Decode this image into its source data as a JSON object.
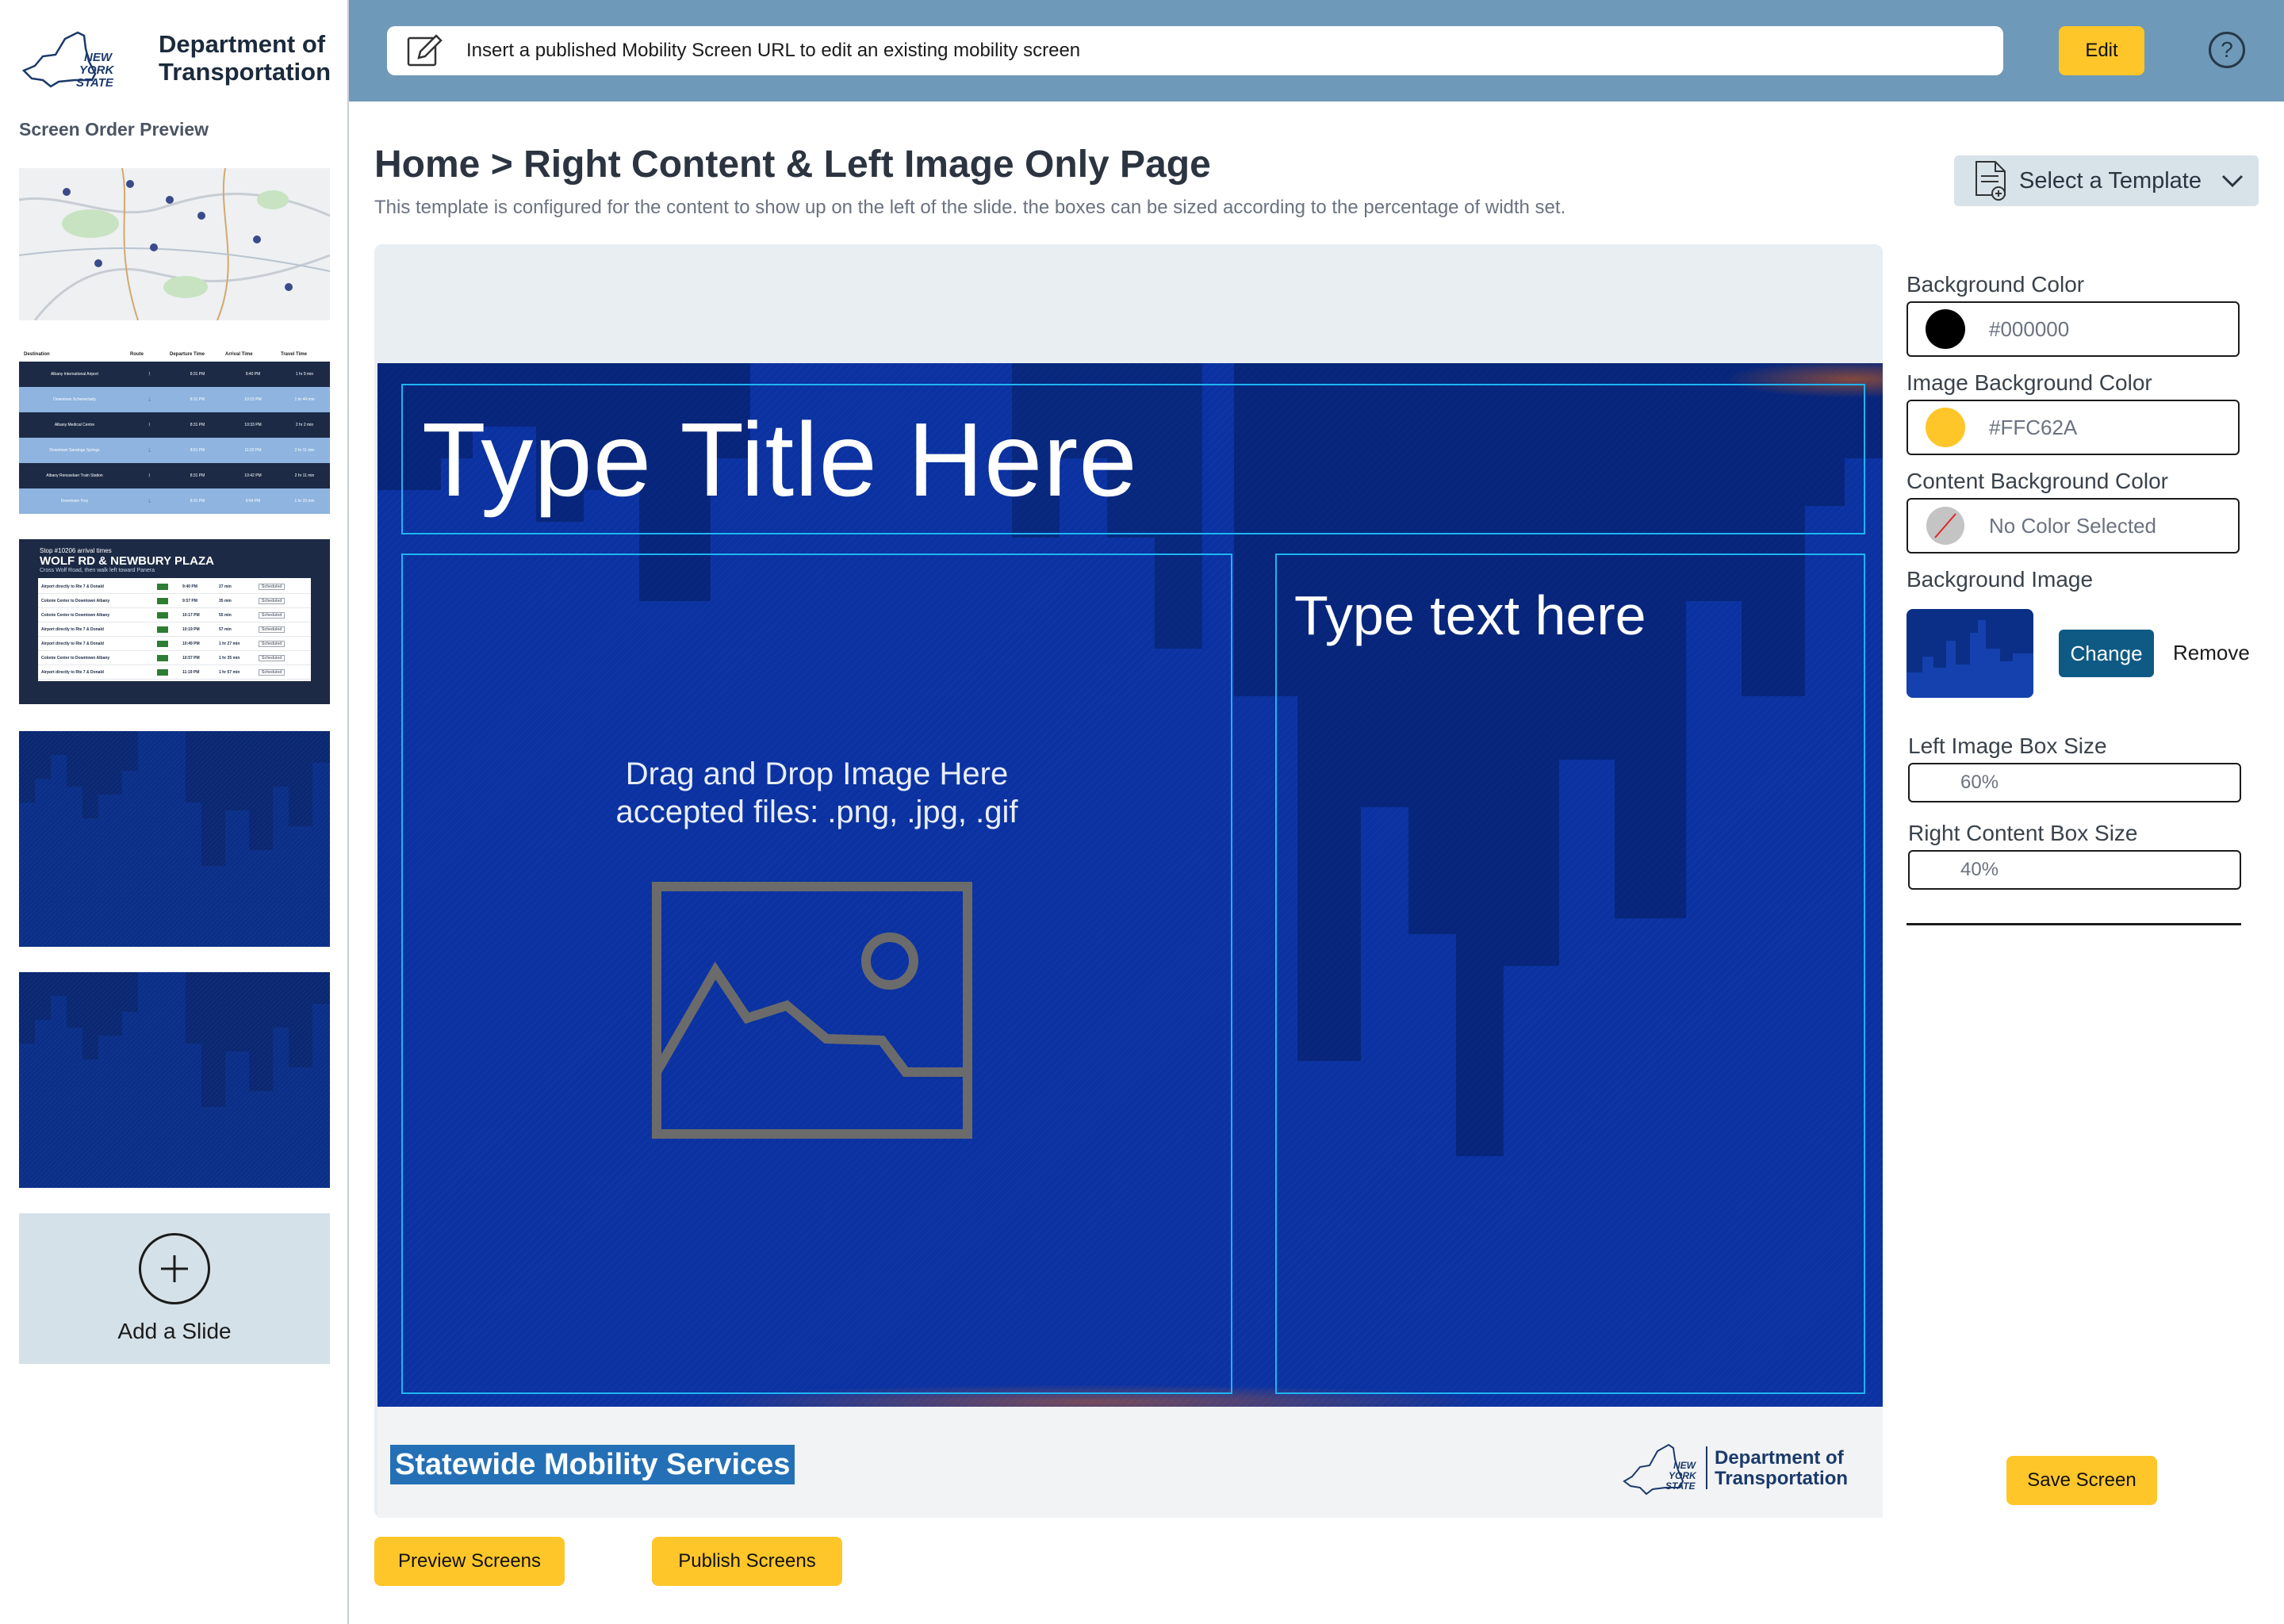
{
  "sidebar": {
    "logo_state_text": "NEW YORK STATE",
    "brand_line1": "Department of",
    "brand_line2": "Transportation",
    "heading": "Screen Order Preview",
    "thumbnails": {
      "table": {
        "headers": [
          "Destination",
          "Route",
          "Departure Time",
          "Arrival Time",
          "Travel Time"
        ],
        "rows": [
          [
            "Albany International Airport",
            "8:31 PM",
            "9:40 PM",
            "1 hr 9 min"
          ],
          [
            "Downtown Schenectady",
            "8:31 PM",
            "10:15 PM",
            "1 hr 44 min"
          ],
          [
            "Albany Medical Centre",
            "8:31 PM",
            "10:33 PM",
            "2 hr 2 min"
          ],
          [
            "Downtown Saratoga Springs",
            "8:51 PM",
            "11:02 PM",
            "2 hr 11 min"
          ],
          [
            "Albany Rensselaer Train Station",
            "8:31 PM",
            "10:42 PM",
            "2 hr 11 min"
          ],
          [
            "Downtown Troy",
            "8:31 PM",
            "9:54 PM",
            "1 hr 23 min"
          ]
        ]
      },
      "stop": {
        "stop_line": "Stop #10206 arrival times",
        "title": "WOLF RD & NEWBURY PLAZA",
        "subtitle": "Cross Wolf Road, then walk left toward Panera",
        "rows": [
          [
            "Airport directly to Rte 7 & Donald",
            "9:40 PM",
            "27 min"
          ],
          [
            "Colonie Center to Downtown Albany",
            "9:57 PM",
            "35 min"
          ],
          [
            "Colonie Center to Downtown Albany",
            "10:17 PM",
            "55 min"
          ],
          [
            "Airport directly to Rte 7 & Donald",
            "10:19 PM",
            "57 min"
          ],
          [
            "Airport directly to Rte 7 & Donald",
            "10:49 PM",
            "1 hr 27 min"
          ],
          [
            "Colonie Center to Downtown Albany",
            "10:57 PM",
            "1 hr 35 min"
          ],
          [
            "Airport directly to Rte 7 & Donald",
            "11:19 PM",
            "1 hr 57 min"
          ]
        ],
        "status": "Scheduled"
      }
    },
    "add_slide_label": "Add a Slide"
  },
  "topbar": {
    "url_placeholder": "Insert a published Mobility Screen URL to edit an existing mobility screen",
    "edit_label": "Edit",
    "help_label": "?"
  },
  "header": {
    "breadcrumb": "Home > Right Content & Left Image Only Page",
    "description": "This template is configured for the content to show up on the left of the slide.  the boxes can be sized according to the percentage of width set.",
    "template_select_label": "Select a Template"
  },
  "slide": {
    "title": "Type Title Here",
    "image_drop_line1": "Drag and Drop Image Here",
    "image_drop_line2": "accepted files: .png, .jpg, .gif",
    "content_placeholder": "Type text here",
    "footer_label": "Statewide Mobility Services",
    "footer_logo_line1": "Department of",
    "footer_logo_line2": "Transportation"
  },
  "panel": {
    "background_color_label": "Background Color",
    "background_color_value": "#000000",
    "image_bg_color_label": "Image Background Color",
    "image_bg_color_value": "#FFC62A",
    "content_bg_color_label": "Content Background Color",
    "content_bg_color_value": "No Color Selected",
    "background_image_label": "Background Image",
    "change_label": "Change",
    "remove_label": "Remove",
    "left_box_label": "Left Image Box Size",
    "left_box_value": "60%",
    "right_box_label": "Right Content Box Size",
    "right_box_value": "40%",
    "save_label": "Save Screen"
  },
  "actions": {
    "preview_label": "Preview Screens",
    "publish_label": "Publish Screens"
  },
  "colors": {
    "accent_yellow": "#FFC62A",
    "topbar_blue": "#6F99B8",
    "slide_blue": "#0A2D7A",
    "frame_cyan": "#1FB4F2",
    "change_button": "#0F5A85"
  }
}
